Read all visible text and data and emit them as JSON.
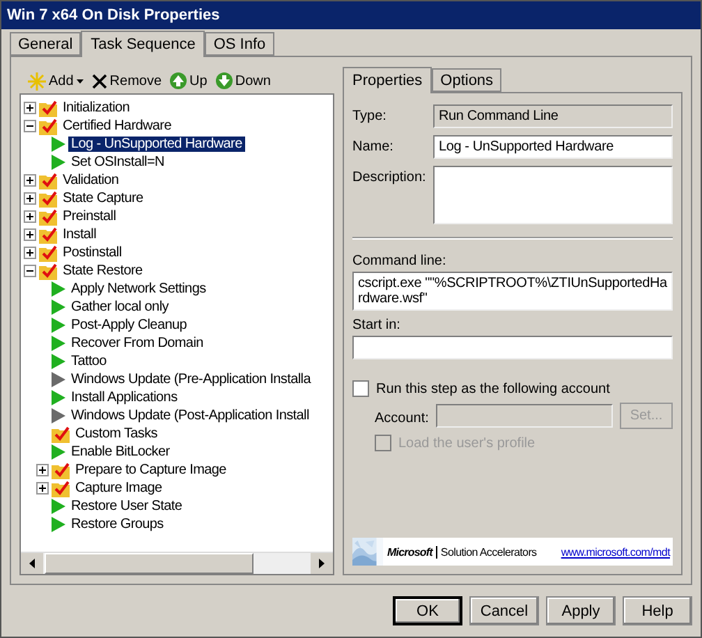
{
  "window": {
    "title": "Win 7 x64 On Disk Properties"
  },
  "tabs": [
    {
      "label": "General",
      "selected": false
    },
    {
      "label": "Task Sequence",
      "selected": true
    },
    {
      "label": "OS Info",
      "selected": false
    }
  ],
  "toolbar": [
    {
      "kind": "add",
      "label": "Add"
    },
    {
      "kind": "remove",
      "label": "Remove"
    },
    {
      "kind": "up",
      "label": "Up"
    },
    {
      "kind": "down",
      "label": "Down"
    }
  ],
  "tree": [
    {
      "kind": "group",
      "label": "Initialization",
      "expanded": false,
      "selected": false
    },
    {
      "kind": "group",
      "label": "Certified Hardware",
      "expanded": true,
      "selected": false,
      "children": [
        {
          "kind": "step",
          "label": "Log - UnSupported Hardware",
          "selected": true,
          "disabled": false
        },
        {
          "kind": "step",
          "label": "Set OSInstall=N",
          "selected": false,
          "disabled": false
        }
      ]
    },
    {
      "kind": "group",
      "label": "Validation",
      "expanded": false,
      "selected": false
    },
    {
      "kind": "group",
      "label": "State Capture",
      "expanded": false,
      "selected": false
    },
    {
      "kind": "group",
      "label": "Preinstall",
      "expanded": false,
      "selected": false
    },
    {
      "kind": "group",
      "label": "Install",
      "expanded": false,
      "selected": false
    },
    {
      "kind": "group",
      "label": "Postinstall",
      "expanded": false,
      "selected": false
    },
    {
      "kind": "group",
      "label": "State Restore",
      "expanded": true,
      "selected": false,
      "children": [
        {
          "kind": "step",
          "label": "Apply Network Settings",
          "selected": false,
          "disabled": false
        },
        {
          "kind": "step",
          "label": "Gather local only",
          "selected": false,
          "disabled": false
        },
        {
          "kind": "step",
          "label": "Post-Apply Cleanup",
          "selected": false,
          "disabled": false
        },
        {
          "kind": "step",
          "label": "Recover From Domain",
          "selected": false,
          "disabled": false
        },
        {
          "kind": "step",
          "label": "Tattoo",
          "selected": false,
          "disabled": false
        },
        {
          "kind": "step",
          "label": "Windows Update (Pre-Application Installa",
          "selected": false,
          "disabled": true
        },
        {
          "kind": "step",
          "label": "Install Applications",
          "selected": false,
          "disabled": false
        },
        {
          "kind": "step",
          "label": "Windows Update (Post-Application Install",
          "selected": false,
          "disabled": true
        },
        {
          "kind": "group",
          "label": "Custom Tasks",
          "selected": false
        },
        {
          "kind": "step",
          "label": "Enable BitLocker",
          "selected": false,
          "disabled": false
        },
        {
          "kind": "group",
          "label": "Prepare to Capture Image",
          "expanded": false,
          "selected": false
        },
        {
          "kind": "group",
          "label": "Capture Image",
          "expanded": false,
          "selected": false
        },
        {
          "kind": "step",
          "label": "Restore User State",
          "selected": false,
          "disabled": false
        },
        {
          "kind": "step",
          "label": "Restore Groups",
          "selected": false,
          "disabled": false
        }
      ]
    }
  ],
  "detail_tabs": [
    {
      "label": "Properties",
      "selected": true
    },
    {
      "label": "Options",
      "selected": false
    }
  ],
  "properties": {
    "type": {
      "label": "Type:",
      "value": "Run Command Line"
    },
    "name": {
      "label": "Name:",
      "value": "Log - UnSupported Hardware"
    },
    "description": {
      "label": "Description:"
    },
    "command_line": {
      "label": "Command line:",
      "value": "cscript.exe \"\"%SCRIPTROOT%\\ZTIUnSupportedHardware.wsf\""
    },
    "start_in": {
      "label": "Start in:"
    },
    "run_as": {
      "label": "Run this step as the following account",
      "checked": false
    },
    "account": {
      "label": "Account:",
      "disabled": true
    },
    "set_button": {
      "label": "Set...",
      "disabled": true
    },
    "load_profile": {
      "label": "Load the user's profile",
      "checked": false,
      "disabled": true
    }
  },
  "banner": {
    "brand": "Microsoft",
    "product": "Solution Accelerators",
    "link": "www.microsoft.com/mdt"
  },
  "buttons": [
    {
      "label": "OK",
      "default": true
    },
    {
      "label": "Cancel",
      "default": false
    },
    {
      "label": "Apply",
      "default": false
    },
    {
      "label": "Help",
      "default": false
    }
  ]
}
